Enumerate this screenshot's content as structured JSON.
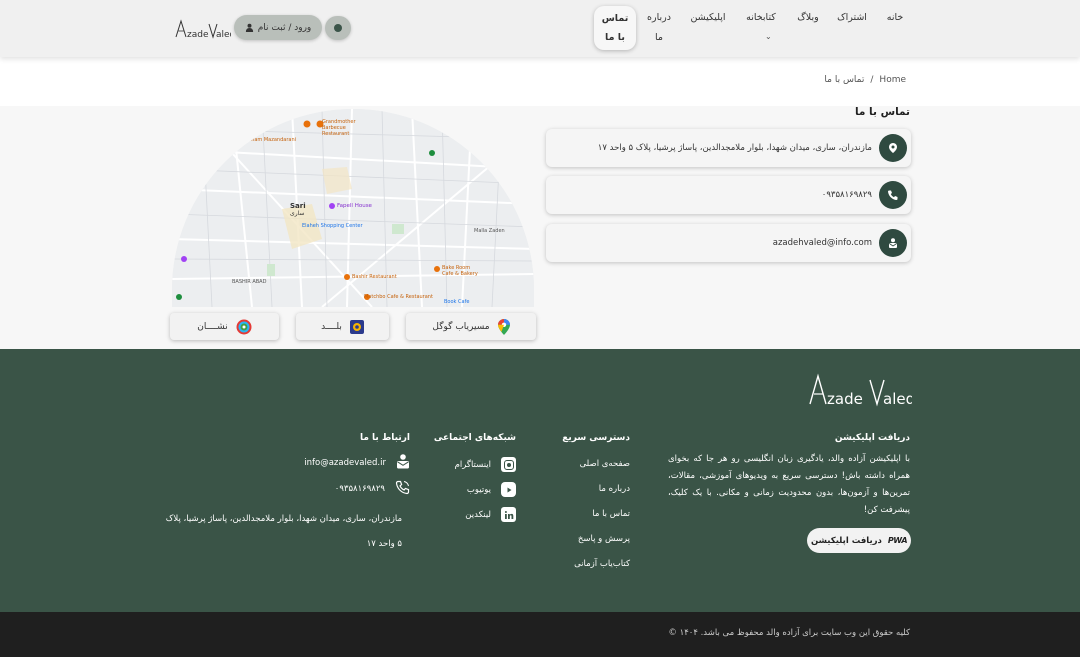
{
  "header": {
    "nav": {
      "home": "خانه",
      "subscription": "اشتراک",
      "blog": "وبلاگ",
      "library": "کتابخانه",
      "application": "اپلیکیشن",
      "about_line1": "درباره",
      "about_line2": "ما",
      "contact_line1": "تماس",
      "contact_line2": "با ما"
    },
    "login_label": "ورود / ثبت نام",
    "logo_text": "Azade Valed"
  },
  "breadcrumb": {
    "home": "Home",
    "separator": "/",
    "current": "تماس با ما"
  },
  "contact": {
    "title": "تماس با ما",
    "address": "مازندران، ساری، میدان شهدا، بلوار ملامجدالدین، پاساژ پرشیا، پلاک ۵ واحد ۱۷",
    "phone": "۰۹۳۵۸۱۶۹۸۲۹",
    "email": "azadehvaled@info.com"
  },
  "map": {
    "labels": {
      "city_en": "Sari",
      "city_fa": "ساری",
      "poi1": "Grandmother Barbecue Restaurant",
      "poi2": "Fapell House",
      "poi3": "Elaheh Shopping Center",
      "poi4": "Malla Zaden",
      "poi5": "Bake Room Cafe & Bakery",
      "poi6": "Bashir Restaurant",
      "poi7": "Matchbo Cafe & Restaurant",
      "poi8": "BASHIR ABAD",
      "poi9": "Imam Mazandarani",
      "poi10": "Book Cafe"
    },
    "buttons": {
      "google": "مسیریاب گوگل",
      "balad": "بلــــد",
      "neshan": "نشــــان"
    }
  },
  "footer": {
    "app_title": "دریافت اپلیکیشن",
    "app_desc": "با اپلیکیشن آزاده والد، یادگیری زبان انگلیسی رو هر جا که بخوای همراه داشته باش! دسترسی سریع به ویدیوهای آموزشی، مقالات، تمرین‌ها و آزمون‌ها، بدون محدودیت زمانی و مکانی. با یک کلیک، پیشرفت کن!",
    "pwa_button": "دریافت اپلیکیشن",
    "pwa_badge": "PWA",
    "quick_title": "دسترسی سریع",
    "quick_links": [
      "صفحه‌ی اصلی",
      "درباره ما",
      "تماس با ما",
      "پرسش و پاسخ",
      "کتاب‌یاب آزمانی"
    ],
    "social_title": "شبکه‌های اجتماعی",
    "social": {
      "instagram": "اینستاگرام",
      "youtube": "یوتیوب",
      "linkedin": "لینکدین"
    },
    "contact_title": "ارتباط با ما",
    "email": "info@azadevaled.ir",
    "phone": "۰۹۳۵۸۱۶۹۸۲۹",
    "address_line1": "مازندران، ساری، میدان شهدا، بلوار ملامجدالدین، پاساژ پرشیا، پلاک",
    "address_line2": "۵ واحد ۱۷",
    "copyright": "کلیه حقوق این وب سایت برای آزاده والد محفوظ می باشد. ۱۴۰۴ ©"
  },
  "colors": {
    "footer_bg": "#3a5447",
    "accent_dark": "#2f4a40",
    "bottom_bar": "#1f1f1f"
  }
}
